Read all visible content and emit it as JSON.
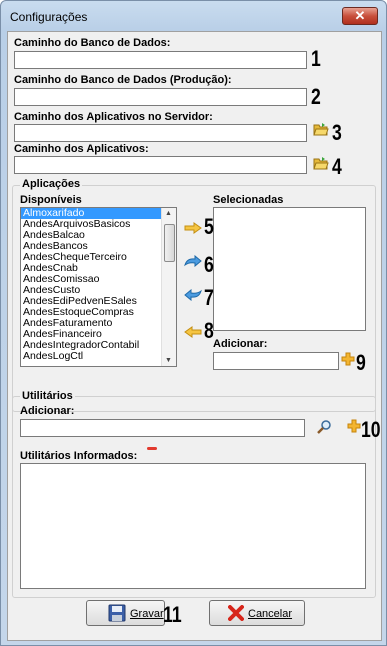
{
  "window": {
    "title": "Configurações",
    "close_label": "✕"
  },
  "paths": {
    "db_label": "Caminho do Banco de Dados:",
    "db_prod_label": "Caminho do Banco de Dados (Produção):",
    "apps_server_label": "Caminho dos Aplicativos no Servidor:",
    "apps_label": "Caminho dos Aplicativos:",
    "db_value": "",
    "db_prod_value": "",
    "apps_server_value": "",
    "apps_value": ""
  },
  "aplicacoes": {
    "group_label": "Aplicações",
    "disponiveis_label": "Disponíveis",
    "selecionadas_label": "Selecionadas",
    "adicionar_label": "Adicionar:",
    "items": [
      "Almoxarifado",
      "AndesArquivosBasicos",
      "AndesBalcao",
      "AndesBancos",
      "AndesChequeTerceiro",
      "AndesCnab",
      "AndesComissao",
      "AndesCusto",
      "AndesEdiPedvenESales",
      "AndesEstoqueCompras",
      "AndesFaturamento",
      "AndesFinanceiro",
      "AndesIntegradorContabil",
      "AndesLogCtl"
    ],
    "selected_index": 0
  },
  "utilitarios": {
    "group_label": "Utilitários",
    "adicionar_label": "Adicionar:",
    "informados_label": "Utilitários Informados:"
  },
  "buttons": {
    "gravar": "Gravar",
    "cancelar": "Cancelar"
  },
  "markers": [
    "1",
    "2",
    "3",
    "4",
    "5",
    "6",
    "7",
    "8",
    "9",
    "10",
    "11"
  ]
}
